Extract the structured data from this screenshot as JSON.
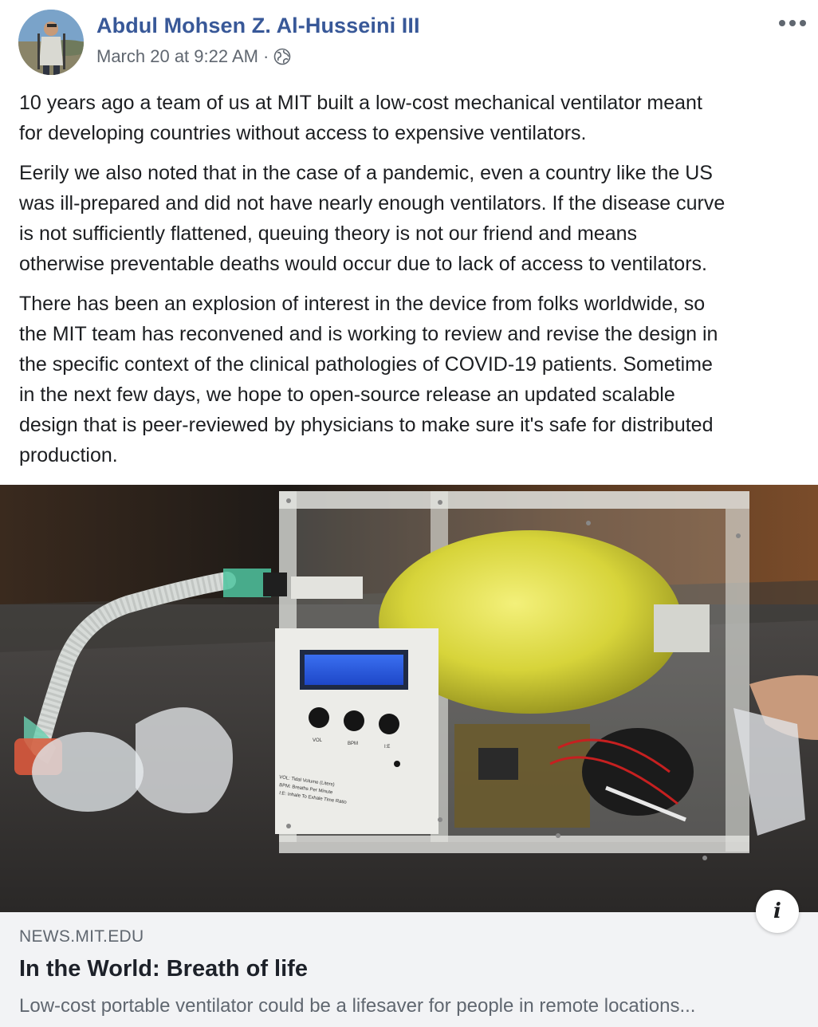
{
  "post": {
    "author": {
      "name": "Abdul Mohsen Z. Al-Husseini III",
      "avatar_icon": "user-photo-avatar"
    },
    "meta": {
      "timestamp": "March 20 at 9:22 AM",
      "separator": "·",
      "privacy_icon": "globe-icon"
    },
    "more_icon": "more-horizontal-icon",
    "paragraphs": [
      "10 years ago a team of us at MIT built a low-cost mechanical ventilator meant\nfor developing countries without access to expensive ventilators.",
      "Eerily we also noted that in the case of a pandemic, even a country like the US\nwas ill-prepared and did not have nearly enough ventilators. If the disease curve\nis not sufficiently flattened, queuing theory is not our friend and means\notherwise preventable deaths would occur due to lack of access to ventilators.",
      "There has been an explosion of interest in the device from folks worldwide, so\nthe MIT team has reconvened and is working to review and revise the design in\nthe specific context of the clinical pathologies of COVID-19 patients. Sometime\nin the next few days, we hope to open-source release an updated scalable\ndesign that is peer-reviewed by physicians to make sure it's safe for distributed\nproduction."
    ],
    "image": {
      "knob_labels": [
        "VOL",
        "BPM",
        "I:E"
      ],
      "legend_lines": [
        "VOL:  Tidal Volume (Liters)",
        "BPM:  Breaths Per Minute",
        "I:E:  Inhale To Exhale Time Ratio"
      ]
    },
    "link_preview": {
      "domain": "NEWS.MIT.EDU",
      "title": "In the World: Breath of life",
      "description": "Low-cost portable ventilator could be a lifesaver for people in remote locations...",
      "info_icon": "info-icon",
      "info_glyph": "i"
    },
    "colors": {
      "author_link": "#385898",
      "meta_text": "#606770",
      "body_text": "#1c1e21",
      "preview_bg": "#f2f3f5"
    }
  }
}
